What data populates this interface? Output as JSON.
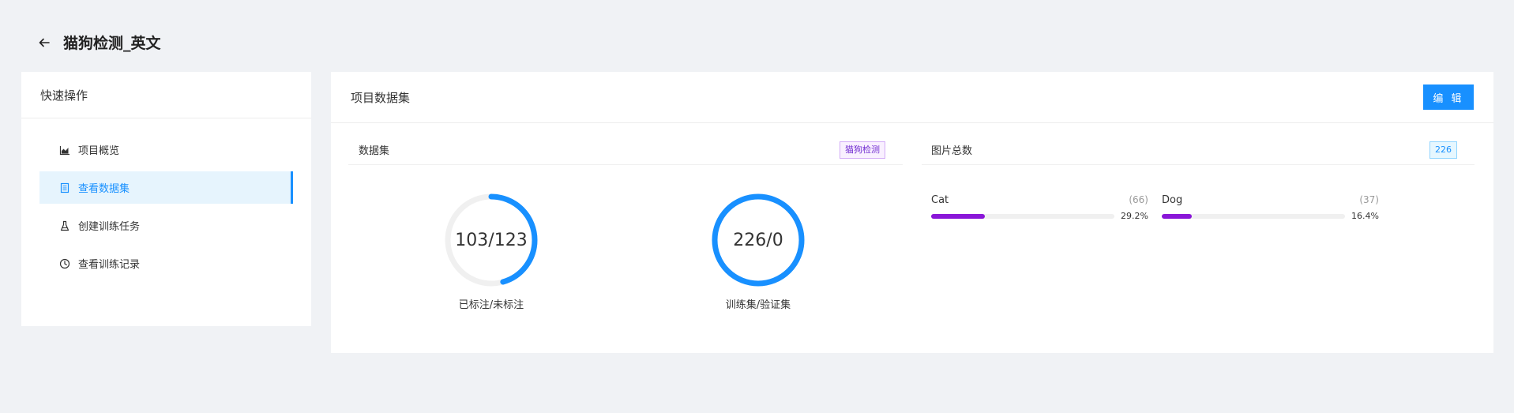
{
  "header": {
    "title": "猫狗检测_英文",
    "back_icon": "arrow-left-icon"
  },
  "sidebar": {
    "title": "快速操作",
    "items": [
      {
        "label": "项目概览",
        "icon": "area-chart-icon",
        "active": false
      },
      {
        "label": "查看数据集",
        "icon": "list-icon",
        "active": true
      },
      {
        "label": "创建训练任务",
        "icon": "flask-icon",
        "active": false
      },
      {
        "label": "查看训练记录",
        "icon": "clock-icon",
        "active": false
      }
    ]
  },
  "main": {
    "title": "项目数据集",
    "edit_label": "编 辑",
    "dataset_panel": {
      "title": "数据集",
      "tag": "猫狗检测",
      "rings": [
        {
          "value": "103/123",
          "label": "已标注/未标注",
          "percent": 45.6
        },
        {
          "value": "226/0",
          "label": "训练集/验证集",
          "percent": 100
        }
      ]
    },
    "images_panel": {
      "title": "图片总数",
      "total": "226",
      "categories": [
        {
          "name": "Cat",
          "count": "(66)",
          "percent_label": "29.2%",
          "percent": 29.2
        },
        {
          "name": "Dog",
          "count": "(37)",
          "percent_label": "16.4%",
          "percent": 16.4
        }
      ]
    }
  },
  "colors": {
    "accent": "#1890ff",
    "bar": "#8a16d8",
    "ring_track": "#f0f0f0"
  }
}
